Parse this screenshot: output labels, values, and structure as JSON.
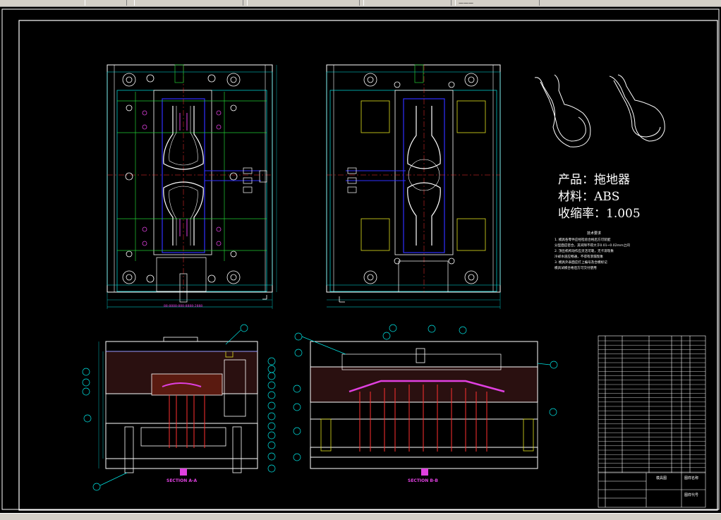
{
  "window": {
    "tabs": [
      "",
      "",
      "",
      "",
      "",
      "",
      "———"
    ]
  },
  "product": {
    "name_line": "产品：拖地器",
    "material_line": "材料：ABS",
    "shrink_line": "收缩率：1.005"
  },
  "notes": {
    "title": "技术要求",
    "lines": [
      "1. 模具各零件应经检验合格后方可装配",
      "分型面应密合，其间隙不得大于0.01~0.02mm之间",
      "2. 顶出机构动作应灵活可靠，无卡滞现象",
      "冷却水道应畅通，不得有渗漏现象",
      "3. 模具外表面应打上编号及合模标记",
      "模具试模合格后方可交付使用"
    ]
  },
  "sections": {
    "a": "SECTION A-A",
    "b": "SECTION B-B"
  },
  "title_block": {
    "cell1": "模具图",
    "cell2": "图样代号",
    "cell3": "图样名称"
  },
  "dim_text": "88-8888-888-8888-2888",
  "colors": {
    "background": "#000000",
    "frame": "#ffffff",
    "cyan": "#00e5e5",
    "green": "#22cc33",
    "magenta": "#e040e0",
    "red": "#ff3030",
    "blue": "#3030ff",
    "yellow": "#e0e020"
  }
}
